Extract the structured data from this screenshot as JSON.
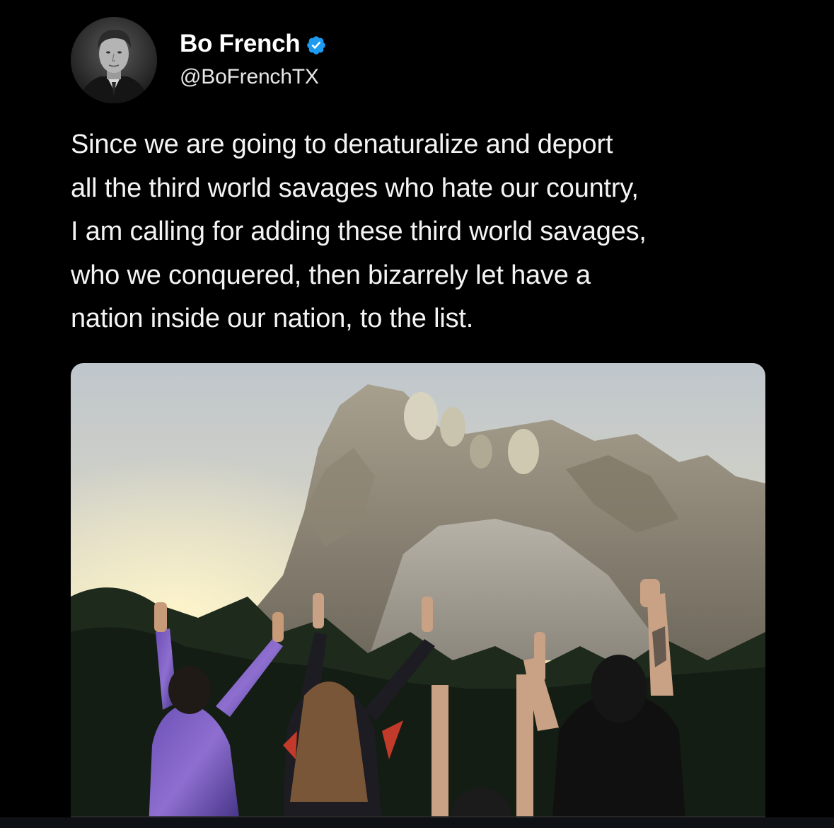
{
  "author": {
    "display_name": "Bo French",
    "handle": "@BoFrenchTX",
    "verified": true,
    "verified_badge_icon": "verified-badge-icon",
    "verified_color": "#1d9bf0"
  },
  "tweet": {
    "text": "Since we are going to denaturalize and deport\nall the third world savages who hate our country,\nI am calling for adding these third world savages,\nwho we conquered, then bizarrely let have a\nnation inside our nation, to the list."
  },
  "media": {
    "kind": "photo"
  },
  "colors": {
    "background": "#000000",
    "text": "#ffffff"
  }
}
